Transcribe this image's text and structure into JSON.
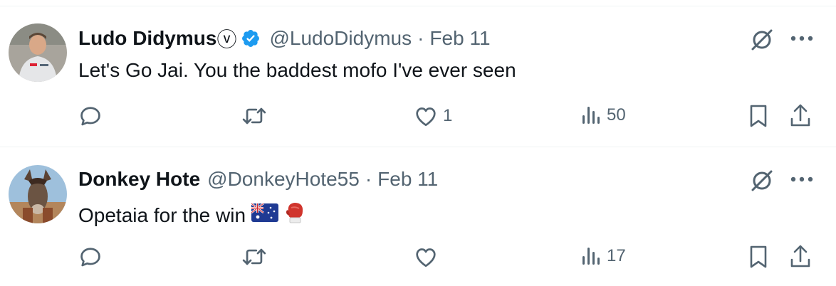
{
  "tweets": [
    {
      "name": "Ludo Didymus",
      "name_suffix": "ⓥ",
      "verified": true,
      "handle": "@LudoDidymus",
      "separator": "·",
      "date": "Feb 11",
      "text": "Let's Go Jai. You the baddest mofo I've ever seen",
      "likes": "1",
      "views": "50"
    },
    {
      "name": "Donkey Hote",
      "verified": false,
      "handle": "@DonkeyHote55",
      "separator": "·",
      "date": "Feb 11",
      "text": "Opetaia for the win",
      "likes": "",
      "views": "17"
    }
  ],
  "icons": {
    "reply": "reply-icon",
    "retweet": "retweet-icon",
    "like": "heart-icon",
    "views": "views-icon",
    "bookmark": "bookmark-icon",
    "share": "share-icon",
    "grok": "grok-icon",
    "more": "more-icon"
  },
  "colors": {
    "verified_blue": "#1d9bf0",
    "secondary_text": "#536471",
    "primary_text": "#0f1419",
    "divider": "#eff3f4"
  }
}
